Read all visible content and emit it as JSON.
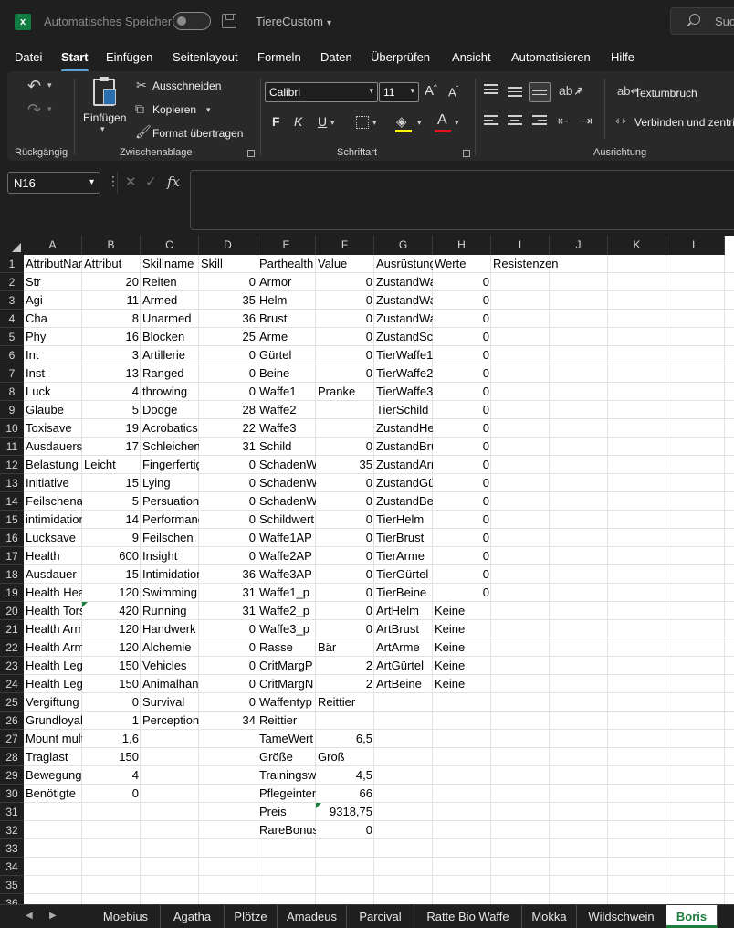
{
  "titlebar": {
    "autosave_label": "Automatisches Speichern",
    "doc_title": "TiereCustom",
    "search_placeholder": "Suc"
  },
  "menu": [
    "Datei",
    "Start",
    "Einfügen",
    "Seitenlayout",
    "Formeln",
    "Daten",
    "Überprüfen",
    "Ansicht",
    "Automatisieren",
    "Hilfe"
  ],
  "active_menu": "Start",
  "ribbon": {
    "groups": {
      "undo": "Rückgängig",
      "clipboard": "Zwischenablage",
      "font": "Schriftart",
      "alignment": "Ausrichtung"
    },
    "paste_label": "Einfügen",
    "cut_label": "Ausschneiden",
    "copy_label": "Kopieren",
    "format_painter_label": "Format übertragen",
    "font_name": "Calibri",
    "font_size": "11",
    "wrap_text_label": "Textumbruch",
    "merge_label": "Verbinden und zentri",
    "bold": "F",
    "italic": "K",
    "underline": "U"
  },
  "formula_bar": {
    "name_box": "N16",
    "fx": "fx",
    "value": ""
  },
  "columns": [
    "A",
    "B",
    "C",
    "D",
    "E",
    "F",
    "G",
    "H",
    "I",
    "J",
    "K",
    "L"
  ],
  "rows": [
    "1",
    "2",
    "3",
    "4",
    "5",
    "6",
    "7",
    "8",
    "9",
    "10",
    "11",
    "12",
    "13",
    "14",
    "15",
    "16",
    "17",
    "18",
    "19",
    "20",
    "21",
    "22",
    "23",
    "24",
    "25",
    "26",
    "27",
    "28",
    "29",
    "30",
    "31",
    "32",
    "33",
    "34",
    "35",
    "36"
  ],
  "cells": {
    "A": [
      "AttributName",
      "Str",
      "Agi",
      "Cha",
      "Phy",
      "Int",
      "Inst",
      "Luck",
      "Glaube",
      "Toxisave",
      "Ausdauersave",
      "Belastung",
      "Initiative",
      "Feilschenaufschlag",
      "intimidation",
      "Lucksave",
      "Health",
      "Ausdauer",
      "Health Head",
      "Health Torso",
      "Health Arm",
      "Health Arm",
      "Health Leg",
      "Health Leg",
      "Vergiftung",
      "Grundloyalität",
      "Mount multiplier",
      "Traglast",
      "Bewegung",
      "Benötigte"
    ],
    "B": [
      "Attribut",
      "20",
      "11",
      "8",
      "16",
      "3",
      "13",
      "4",
      "5",
      "19",
      "17",
      "Leicht",
      "15",
      "5",
      "14",
      "9",
      "600",
      "15",
      "120",
      "420",
      "120",
      "120",
      "150",
      "150",
      "0",
      "1",
      "1,6",
      "150",
      "4",
      "0"
    ],
    "C": [
      "Skillname",
      "Reiten",
      "Armed",
      "Unarmed",
      "Blocken",
      "Artillerie",
      "Ranged",
      "throwing",
      "Dodge",
      "Acrobatics",
      "Schleichen",
      "Fingerfertigkeit",
      "Lying",
      "Persuation",
      "Performance",
      "Feilschen",
      "Insight",
      "Intimidation",
      "Swimming",
      "Running",
      "Handwerk",
      "Alchemie",
      "Vehicles",
      "Animalhandling",
      "Survival",
      "Perception"
    ],
    "D": [
      "Skill",
      "0",
      "35",
      "36",
      "25",
      "0",
      "0",
      "0",
      "28",
      "22",
      "31",
      "0",
      "0",
      "0",
      "0",
      "0",
      "0",
      "36",
      "31",
      "31",
      "0",
      "0",
      "0",
      "0",
      "0",
      "34"
    ],
    "E": [
      "Parthealth",
      "Armor",
      "Helm",
      "Brust",
      "Arme",
      "Gürtel",
      "Beine",
      "Waffe1",
      "Waffe2",
      "Waffe3",
      "Schild",
      "SchadenWaffe1",
      "SchadenWaffe2",
      "SchadenWaffe3",
      "Schildwert",
      "Waffe1AP",
      "Waffe2AP",
      "Waffe3AP",
      "Waffe1_p",
      "Waffe2_p",
      "Waffe3_p",
      "Rasse",
      "CritMargP",
      "CritMargN",
      "Waffentyp",
      "Reittier",
      "TameWert",
      "Größe",
      "Trainingswert",
      "Pflegeintensität",
      "Preis",
      "RareBonus"
    ],
    "F": [
      "Value",
      "0",
      "0",
      "0",
      "0",
      "0",
      "0",
      "Pranke",
      "",
      "",
      "0",
      "35",
      "0",
      "0",
      "0",
      "0",
      "0",
      "0",
      "0",
      "0",
      "0",
      "Bär",
      "2",
      "2",
      "Reittier",
      "",
      "6,5",
      "Groß",
      "4,5",
      "66",
      "9318,75",
      "0"
    ],
    "G": [
      "Ausrüstung",
      "ZustandWaffe1",
      "ZustandWaffe2",
      "ZustandWaffe3",
      "ZustandSchild",
      "TierWaffe1",
      "TierWaffe2",
      "TierWaffe3",
      "TierSchild",
      "ZustandHelm",
      "ZustandBrust",
      "ZustandArme",
      "ZustandGürtel",
      "ZustandBeine",
      "TierHelm",
      "TierBrust",
      "TierArme",
      "TierGürtel",
      "TierBeine",
      "ArtHelm",
      "ArtBrust",
      "ArtArme",
      "ArtGürtel",
      "ArtBeine"
    ],
    "H": [
      "Werte",
      "0",
      "0",
      "0",
      "0",
      "0",
      "0",
      "0",
      "0",
      "0",
      "0",
      "0",
      "0",
      "0",
      "0",
      "0",
      "0",
      "0",
      "0",
      "Keine",
      "Keine",
      "Keine",
      "Keine",
      "Keine"
    ],
    "I": [
      "Resistenzen"
    ]
  },
  "sheet_tabs": [
    "Moebius",
    "Agatha",
    "Plötze",
    "Amadeus",
    "Parcival",
    "Ratte Bio Waffe",
    "Mokka",
    "Wildschwein",
    "Boris"
  ],
  "active_sheet": "Boris"
}
